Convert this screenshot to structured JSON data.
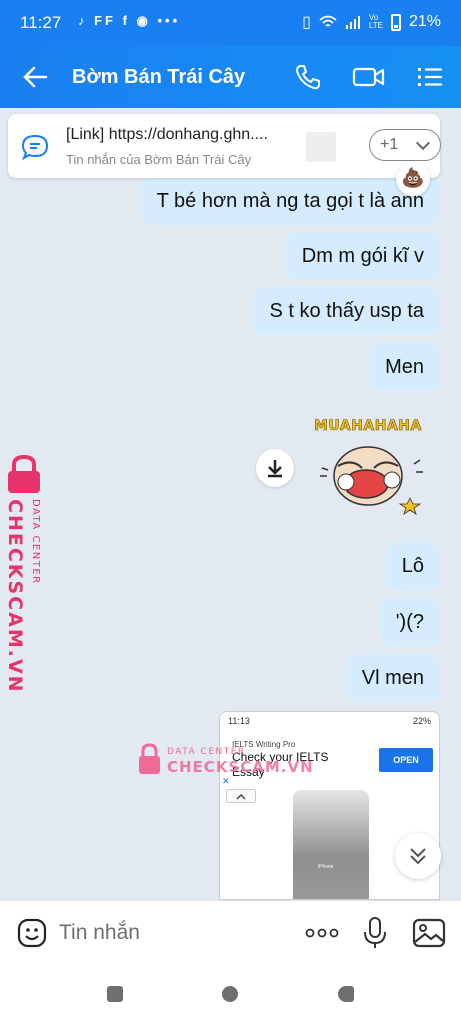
{
  "status_bar": {
    "time": "11:27",
    "left_icons": "♪ FF f ◉ •••",
    "battery": "21%"
  },
  "header": {
    "title": "Bờm Bán Trái Cây"
  },
  "pinned": {
    "line1": "[Link] https://donhang.ghn....",
    "line2": "Tin nhắn của Bờm Bán Trái Cây",
    "more_label": "+1"
  },
  "messages": [
    "T bé hơn mà ng ta gọi t là anh",
    "Dm m gói kĩ v",
    "S t ko thấy usp ta",
    "Men",
    "Lô",
    "')(?",
    "Vl men"
  ],
  "sticker": {
    "caption": "MUAHAHAHA"
  },
  "watermark": {
    "side_brand": "CHECKSCAM.VN",
    "side_sub": "DATA CENTER",
    "mid_sub": "DATA CENTER",
    "mid_brand": "CHECKSCAM.VN"
  },
  "screenshot_preview": {
    "time": "11:13",
    "battery": "22%",
    "ad_small": "IELTS Writing Pro",
    "ad_title": "Check your IELTS Essay",
    "ad_button": "OPEN",
    "phone_label": "iPhone"
  },
  "composer": {
    "placeholder": "Tin nhắn"
  },
  "colors": {
    "brand_blue": "#1a7ff0",
    "bubble": "#d4ecfd",
    "background": "#e2e9f1",
    "watermark_pink": "#e8336d"
  }
}
